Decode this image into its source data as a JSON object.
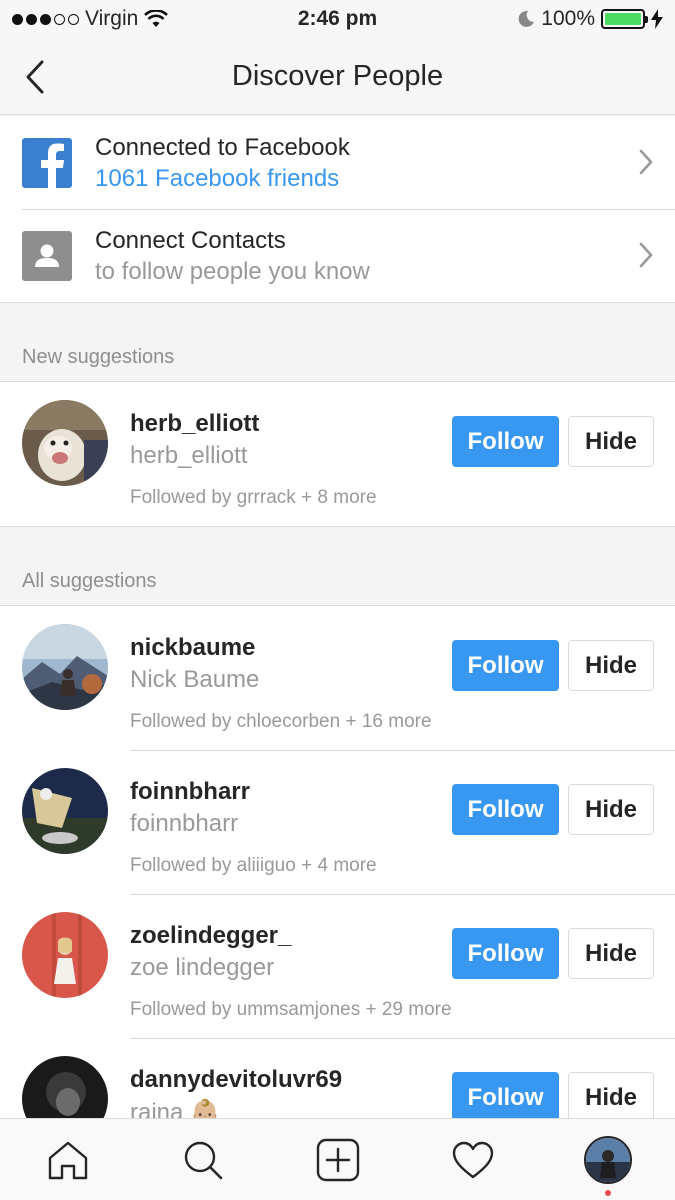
{
  "status": {
    "carrier": "Virgin",
    "time": "2:46 pm",
    "battery": "100%",
    "icons": [
      "signal-dots-icon",
      "wifi-icon",
      "moon-icon",
      "battery-icon",
      "charging-bolt-icon"
    ]
  },
  "nav": {
    "title": "Discover People",
    "back_icon": "back-chevron-icon"
  },
  "connect": {
    "facebook": {
      "title": "Connected to Facebook",
      "subtitle": "1061 Facebook friends",
      "icon": "facebook-icon"
    },
    "contacts": {
      "title": "Connect Contacts",
      "subtitle": "to follow people you know",
      "icon": "contact-icon"
    }
  },
  "sections": {
    "new": "New suggestions",
    "all": "All suggestions"
  },
  "new_suggestions": [
    {
      "username": "herb_elliott",
      "fullname": "herb_elliott",
      "followed_by": "Followed by grrrack + 8 more",
      "follow": "Follow",
      "hide": "Hide"
    }
  ],
  "all_suggestions": [
    {
      "username": "nickbaume",
      "fullname": "Nick Baume",
      "followed_by": "Followed by chloecorben + 16 more",
      "follow": "Follow",
      "hide": "Hide"
    },
    {
      "username": "foinnbharr",
      "fullname": "foinnbharr",
      "followed_by": "Followed by aliiiguo + 4 more",
      "follow": "Follow",
      "hide": "Hide"
    },
    {
      "username": "zoelindegger_",
      "fullname": "zoe lindegger",
      "followed_by": "Followed by ummsamjones + 29 more",
      "follow": "Follow",
      "hide": "Hide"
    },
    {
      "username": "dannydevitoluvr69",
      "fullname": "raina 👶🏼",
      "followed_by": "",
      "follow": "Follow",
      "hide": "Hide"
    }
  ],
  "tabs": [
    "home-icon",
    "search-icon",
    "add-post-icon",
    "heart-icon",
    "profile-avatar"
  ],
  "colors": {
    "accent": "#3897f0",
    "facebook": "#3b7fd0",
    "battery": "#4cd964",
    "notification": "#ed4956"
  }
}
